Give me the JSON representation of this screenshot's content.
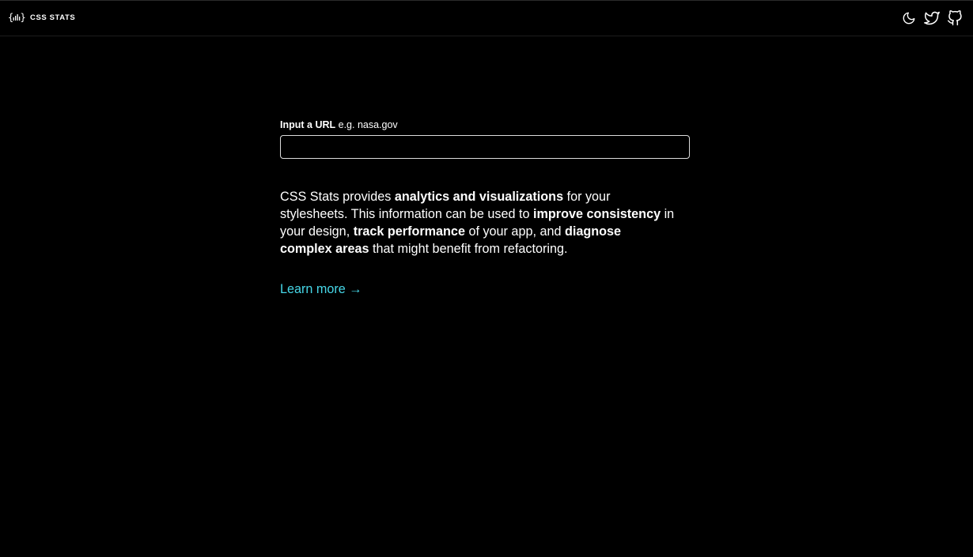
{
  "header": {
    "brand_name": "CSS STATS",
    "logo_icon": "css-stats-logo",
    "icons": [
      "moon-icon",
      "twitter-icon",
      "github-icon"
    ]
  },
  "form": {
    "label_strong": "Input a URL",
    "label_hint": "e.g. nasa.gov",
    "input_value": "",
    "input_placeholder": ""
  },
  "description": {
    "p1": "CSS Stats provides ",
    "b1": "analytics and visualizations",
    "p2": " for your stylesheets. This information can be used to ",
    "b2": "improve consistency",
    "p3": " in your design, ",
    "b3": "track performance",
    "p4": " of your app, and ",
    "b4": "diagnose complex areas",
    "p5": " that might benefit from refactoring."
  },
  "learn_more": "Learn more →",
  "colors": {
    "background": "#000000",
    "text": "#ffffff",
    "link": "#46d7e8"
  }
}
